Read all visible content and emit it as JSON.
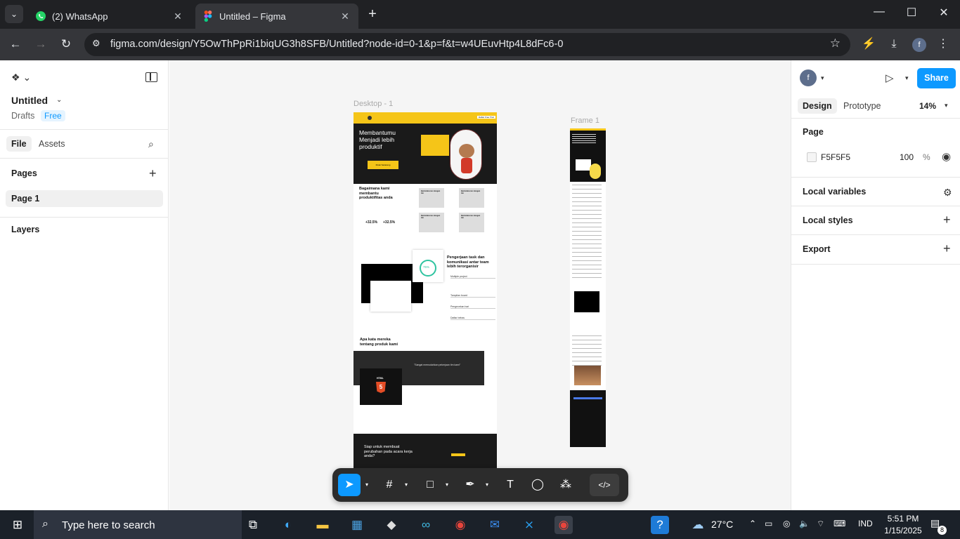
{
  "browser": {
    "tabs": [
      {
        "label": "(2) WhatsApp",
        "active": false
      },
      {
        "label": "Untitled – Figma",
        "active": true
      }
    ],
    "url": "figma.com/design/Y5OwThPpRi1biqUG3h8SFB/Untitled?node-id=0-1&p=f&t=w4UEuvHtp4L8dFc6-0",
    "profile_initial": "f"
  },
  "figma": {
    "left": {
      "doc_title": "Untitled",
      "drafts": "Drafts",
      "plan_badge": "Free",
      "tabs": [
        "File",
        "Assets"
      ],
      "pages_heading": "Pages",
      "page_item": "Page 1",
      "layers_heading": "Layers"
    },
    "right": {
      "avatar_initial": "f",
      "share": "Share",
      "tabs": [
        "Design",
        "Prototype"
      ],
      "zoom": "14%",
      "page_heading": "Page",
      "bg_hex": "F5F5F5",
      "bg_opacity": "100",
      "percent": "%",
      "local_variables": "Local variables",
      "local_styles": "Local styles",
      "export": "Export"
    },
    "canvas": {
      "frames": [
        "Desktop - 1",
        "Frame 1"
      ],
      "desktop": {
        "hero_title": "Membantumu Menjadi lebih produktif",
        "hero_cta": "Mulai Sekarang",
        "nav_button": "Daftar Free Trial",
        "section2_title": "Bagaimana kami membantu produktifitas anda",
        "stat1": "+32.5%",
        "stat2": "+32.5%",
        "card_title": "Berkolaborasi dengan tim",
        "section3_title": "Pengerjaan task dan komunikasi antar team lebih terorganisir",
        "progress": "75%",
        "list_items": [
          "Multiple project",
          "Tampilan board",
          "Pengecekan hari",
          "Daftar bebas"
        ],
        "testimonial_title": "Apa kata mereka tentang produk kami",
        "html_badge": "HTML",
        "html_version": "5",
        "quote": "\"Sangat memudahkan pekerjaan tim kami\"",
        "cta_title": "Siap untuk membuat perubahan pada acara kerja anda?"
      }
    },
    "help": "?"
  },
  "taskbar": {
    "search_placeholder": "Type here to search",
    "temperature": "27°C",
    "lang": "IND",
    "time": "5:51 PM",
    "date": "1/15/2025",
    "notifications": "8"
  },
  "colors": {
    "accent": "#0d99ff",
    "yellow": "#f5c518",
    "dark": "#1e1e1e"
  }
}
